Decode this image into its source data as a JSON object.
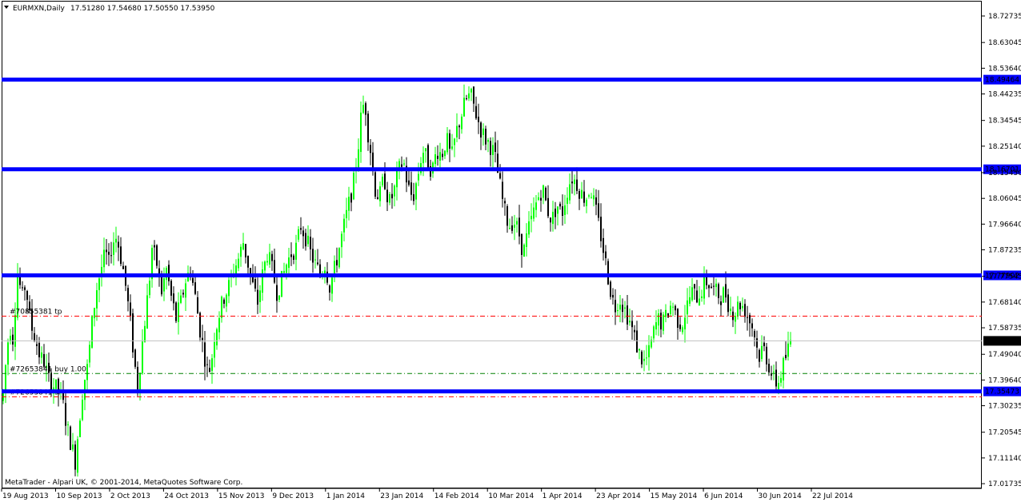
{
  "header": {
    "symbol": "EURMXN,Daily",
    "ohlc": "17.51280 17.54680 17.50550 17.53950"
  },
  "copyright": "MetaTrader - Alpari UK, © 2001-2014, MetaQuotes Software Corp.",
  "colors": {
    "bull": "#00ff00",
    "bear": "#000000",
    "level_line": "#0000ff",
    "level_label_bg": "#0000ff",
    "current_price_bg": "#000000",
    "tp_line": "#ff0000",
    "entry_line": "#008000",
    "sl_line": "#ff0000",
    "bid_line": "#c0c0c0",
    "grid": "#808080"
  },
  "chart_data": {
    "type": "candlestick",
    "title": "EURMXN,Daily",
    "y_range": [
      17.0,
      18.78
    ],
    "y_ticks": [
      "18.72735",
      "18.63045",
      "18.53640",
      "18.44235",
      "18.34545",
      "18.25140",
      "18.15450",
      "18.06045",
      "17.96640",
      "17.87235",
      "17.77545",
      "17.68140",
      "17.58735",
      "17.49040",
      "17.39640",
      "17.30235",
      "17.20545",
      "17.11140",
      "17.01735"
    ],
    "x_labels": [
      "19 Aug 2013",
      "10 Sep 2013",
      "2 Oct 2013",
      "24 Oct 2013",
      "15 Nov 2013",
      "9 Dec 2013",
      "1 Jan 2014",
      "23 Jan 2014",
      "14 Feb 2014",
      "10 Mar 2014",
      "1 Apr 2014",
      "23 Apr 2014",
      "15 May 2014",
      "6 Jun 2014",
      "30 Jun 2014",
      "22 Jul 2014"
    ],
    "levels": [
      {
        "value": "18.49464"
      },
      {
        "value": "18.16701"
      },
      {
        "value": "17.77902"
      },
      {
        "value": "17.35473"
      }
    ],
    "current_price": "17.53950",
    "orders": [
      {
        "label": "#70855381 tp",
        "price": 17.63,
        "kind": "tp"
      },
      {
        "label": "#72653841 buy 1.00",
        "price": 17.42,
        "kind": "entry"
      },
      {
        "label": "#72653841 sl",
        "price": 17.335,
        "kind": "sl"
      }
    ],
    "path_points": [
      [
        0,
        17.22
      ],
      [
        6,
        17.42
      ],
      [
        12,
        17.6
      ],
      [
        16,
        17.55
      ],
      [
        22,
        17.78
      ],
      [
        28,
        17.7
      ],
      [
        32,
        17.75
      ],
      [
        38,
        17.6
      ],
      [
        44,
        17.55
      ],
      [
        50,
        17.48
      ],
      [
        56,
        17.46
      ],
      [
        60,
        17.4
      ],
      [
        66,
        17.38
      ],
      [
        72,
        17.36
      ],
      [
        78,
        17.32
      ],
      [
        84,
        17.22
      ],
      [
        90,
        17.15
      ],
      [
        94,
        17.1
      ],
      [
        98,
        17.22
      ],
      [
        104,
        17.38
      ],
      [
        110,
        17.45
      ],
      [
        114,
        17.58
      ],
      [
        120,
        17.72
      ],
      [
        126,
        17.8
      ],
      [
        132,
        17.86
      ],
      [
        136,
        17.82
      ],
      [
        140,
        17.9
      ],
      [
        146,
        17.92
      ],
      [
        150,
        17.86
      ],
      [
        154,
        17.8
      ],
      [
        158,
        17.72
      ],
      [
        164,
        17.58
      ],
      [
        168,
        17.46
      ],
      [
        172,
        17.38
      ],
      [
        176,
        17.48
      ],
      [
        182,
        17.64
      ],
      [
        186,
        17.74
      ],
      [
        190,
        17.88
      ],
      [
        196,
        17.82
      ],
      [
        202,
        17.72
      ],
      [
        208,
        17.8
      ],
      [
        214,
        17.7
      ],
      [
        220,
        17.62
      ],
      [
        226,
        17.68
      ],
      [
        232,
        17.76
      ],
      [
        238,
        17.8
      ],
      [
        244,
        17.7
      ],
      [
        250,
        17.58
      ],
      [
        256,
        17.48
      ],
      [
        260,
        17.42
      ],
      [
        264,
        17.46
      ],
      [
        268,
        17.56
      ],
      [
        274,
        17.64
      ],
      [
        280,
        17.7
      ],
      [
        286,
        17.74
      ],
      [
        292,
        17.8
      ],
      [
        298,
        17.84
      ],
      [
        304,
        17.9
      ],
      [
        310,
        17.82
      ],
      [
        316,
        17.74
      ],
      [
        322,
        17.68
      ],
      [
        328,
        17.78
      ],
      [
        334,
        17.86
      ],
      [
        340,
        17.8
      ],
      [
        346,
        17.72
      ],
      [
        352,
        17.76
      ],
      [
        358,
        17.82
      ],
      [
        364,
        17.86
      ],
      [
        370,
        17.88
      ],
      [
        376,
        17.96
      ],
      [
        382,
        17.92
      ],
      [
        388,
        17.86
      ],
      [
        394,
        17.82
      ],
      [
        400,
        17.78
      ],
      [
        406,
        17.82
      ],
      [
        412,
        17.74
      ],
      [
        418,
        17.8
      ],
      [
        424,
        17.88
      ],
      [
        430,
        17.96
      ],
      [
        436,
        18.04
      ],
      [
        442,
        18.12
      ],
      [
        448,
        18.26
      ],
      [
        452,
        18.38
      ],
      [
        456,
        18.42
      ],
      [
        460,
        18.3
      ],
      [
        464,
        18.22
      ],
      [
        468,
        18.1
      ],
      [
        474,
        18.06
      ],
      [
        480,
        18.14
      ],
      [
        486,
        18.04
      ],
      [
        492,
        18.08
      ],
      [
        498,
        18.16
      ],
      [
        504,
        18.2
      ],
      [
        510,
        18.1
      ],
      [
        516,
        18.06
      ],
      [
        522,
        18.14
      ],
      [
        528,
        18.24
      ],
      [
        534,
        18.2
      ],
      [
        540,
        18.16
      ],
      [
        546,
        18.24
      ],
      [
        552,
        18.22
      ],
      [
        558,
        18.28
      ],
      [
        564,
        18.2
      ],
      [
        570,
        18.3
      ],
      [
        576,
        18.36
      ],
      [
        582,
        18.42
      ],
      [
        588,
        18.44
      ],
      [
        594,
        18.38
      ],
      [
        600,
        18.32
      ],
      [
        606,
        18.28
      ],
      [
        612,
        18.26
      ],
      [
        618,
        18.22
      ],
      [
        624,
        18.12
      ],
      [
        630,
        18.02
      ],
      [
        636,
        17.96
      ],
      [
        642,
        17.98
      ],
      [
        648,
        17.94
      ],
      [
        654,
        17.86
      ],
      [
        660,
        17.94
      ],
      [
        666,
        18.0
      ],
      [
        672,
        18.06
      ],
      [
        678,
        18.1
      ],
      [
        684,
        18.02
      ],
      [
        690,
        17.98
      ],
      [
        696,
        18.04
      ],
      [
        702,
        18.0
      ],
      [
        708,
        18.08
      ],
      [
        714,
        18.14
      ],
      [
        720,
        18.12
      ],
      [
        726,
        18.08
      ],
      [
        732,
        18.06
      ],
      [
        738,
        18.1
      ],
      [
        744,
        18.02
      ],
      [
        750,
        17.94
      ],
      [
        756,
        17.84
      ],
      [
        762,
        17.74
      ],
      [
        768,
        17.66
      ],
      [
        774,
        17.7
      ],
      [
        780,
        17.66
      ],
      [
        786,
        17.62
      ],
      [
        792,
        17.56
      ],
      [
        798,
        17.5
      ],
      [
        804,
        17.46
      ],
      [
        810,
        17.48
      ],
      [
        816,
        17.56
      ],
      [
        822,
        17.62
      ],
      [
        828,
        17.6
      ],
      [
        834,
        17.64
      ],
      [
        840,
        17.68
      ],
      [
        846,
        17.62
      ],
      [
        852,
        17.6
      ],
      [
        858,
        17.66
      ],
      [
        864,
        17.72
      ],
      [
        870,
        17.7
      ],
      [
        876,
        17.72
      ],
      [
        882,
        17.76
      ],
      [
        888,
        17.74
      ],
      [
        894,
        17.72
      ],
      [
        900,
        17.7
      ],
      [
        906,
        17.72
      ],
      [
        912,
        17.66
      ],
      [
        918,
        17.64
      ],
      [
        924,
        17.68
      ],
      [
        930,
        17.66
      ],
      [
        936,
        17.62
      ],
      [
        942,
        17.58
      ],
      [
        948,
        17.48
      ],
      [
        954,
        17.52
      ],
      [
        960,
        17.46
      ],
      [
        966,
        17.4
      ],
      [
        972,
        17.38
      ],
      [
        978,
        17.44
      ],
      [
        984,
        17.5
      ],
      [
        988,
        17.54
      ]
    ]
  }
}
